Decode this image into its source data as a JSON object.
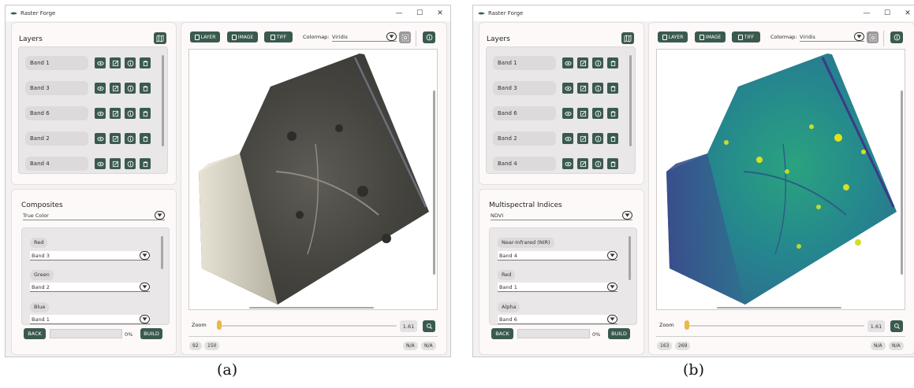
{
  "app": {
    "title": "Raster Forge"
  },
  "window_controls": {
    "minimize": "—",
    "maximize": "☐",
    "close": "✕"
  },
  "icon_names": [
    "map-icon",
    "eye-icon",
    "edit-icon",
    "info-icon",
    "trash-icon",
    "save-icon",
    "lock-icon",
    "chevron-down-icon",
    "search-icon"
  ],
  "colors": {
    "accent": "#3b5a4f",
    "slider_thumb": "#e7b94a",
    "panel": "#fdf9f9"
  },
  "panels": [
    {
      "caption": "(a)",
      "layers": {
        "title": "Layers",
        "items": [
          {
            "label": "Band 1"
          },
          {
            "label": "Band 3"
          },
          {
            "label": "Band 6"
          },
          {
            "label": "Band 2"
          },
          {
            "label": "Band 4"
          }
        ]
      },
      "section": {
        "title": "Composites",
        "selected": "True Color",
        "channels": [
          {
            "label": "Red",
            "value": "Band 3"
          },
          {
            "label": "Green",
            "value": "Band 2"
          },
          {
            "label": "Blue",
            "value": "Band 1"
          }
        ]
      },
      "footer": {
        "back": "BACK",
        "build": "BUILD",
        "progress_value": 0,
        "progress_label": "0%"
      },
      "toolbar": {
        "layer": "LAYER",
        "image": "IMAGE",
        "tiff": "TIFF",
        "colormap_label": "Colormap:",
        "colormap_value": "Viridis"
      },
      "zoom": {
        "label": "Zoom",
        "value": "1.61"
      },
      "status": {
        "x": "92",
        "y": "150",
        "v1": "N/A",
        "v2": "N/A"
      }
    },
    {
      "caption": "(b)",
      "layers": {
        "title": "Layers",
        "items": [
          {
            "label": "Band 1"
          },
          {
            "label": "Band 3"
          },
          {
            "label": "Band 6"
          },
          {
            "label": "Band 2"
          },
          {
            "label": "Band 4"
          }
        ]
      },
      "section": {
        "title": "Multispectral Indices",
        "selected": "NDVI",
        "channels": [
          {
            "label": "Near-Infrared (NIR)",
            "value": "Band 4"
          },
          {
            "label": "Red",
            "value": "Band 1"
          },
          {
            "label": "Alpha",
            "value": "Band 6"
          }
        ]
      },
      "footer": {
        "back": "BACK",
        "build": "BUILD",
        "progress_value": 0,
        "progress_label": "0%"
      },
      "toolbar": {
        "layer": "LAYER",
        "image": "IMAGE",
        "tiff": "TIFF",
        "colormap_label": "Colormap:",
        "colormap_value": "Viridis"
      },
      "zoom": {
        "label": "Zoom",
        "value": "1.61"
      },
      "status": {
        "x": "163",
        "y": "269",
        "v1": "N/A",
        "v2": "N/A"
      }
    }
  ]
}
